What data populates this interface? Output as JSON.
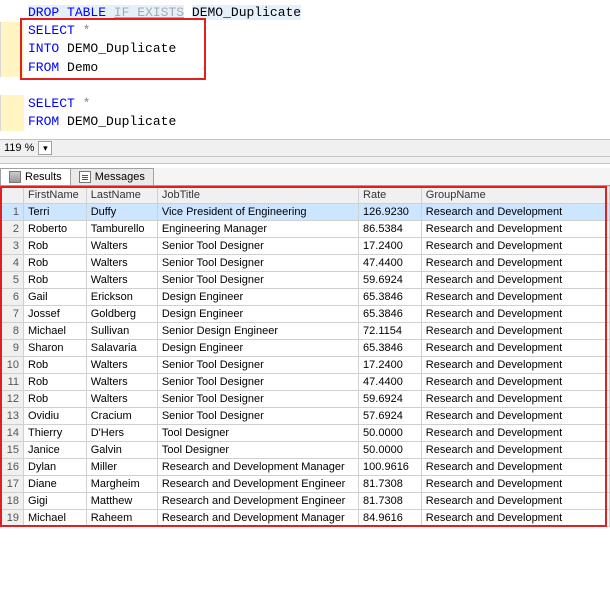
{
  "editor": {
    "l1_drop": "DROP",
    "l1_table": "TABLE",
    "l1_ifexists": "IF EXISTS",
    "l1_obj": "DEMO_Duplicate",
    "l2_select": "SELECT",
    "l2_star": "*",
    "l3_into": "INTO",
    "l3_obj": "DEMO_Duplicate",
    "l4_from": "FROM",
    "l4_obj": "Demo",
    "l6_select": "SELECT",
    "l6_star": "*",
    "l7_from": "FROM",
    "l7_obj": "DEMO_Duplicate"
  },
  "zoom": {
    "value": "119 %"
  },
  "tabs": {
    "results": "Results",
    "messages": "Messages"
  },
  "grid": {
    "headers": {
      "firstname": "FirstName",
      "lastname": "LastName",
      "jobtitle": "JobTitle",
      "rate": "Rate",
      "groupname": "GroupName"
    },
    "rows": [
      {
        "n": "1",
        "fn": "Terri",
        "ln": "Duffy",
        "jt": "Vice President of Engineering",
        "rt": "126.9230",
        "gn": "Research and Development"
      },
      {
        "n": "2",
        "fn": "Roberto",
        "ln": "Tamburello",
        "jt": "Engineering Manager",
        "rt": "86.5384",
        "gn": "Research and Development"
      },
      {
        "n": "3",
        "fn": "Rob",
        "ln": "Walters",
        "jt": "Senior Tool Designer",
        "rt": "17.2400",
        "gn": "Research and Development"
      },
      {
        "n": "4",
        "fn": "Rob",
        "ln": "Walters",
        "jt": "Senior Tool Designer",
        "rt": "47.4400",
        "gn": "Research and Development"
      },
      {
        "n": "5",
        "fn": "Rob",
        "ln": "Walters",
        "jt": "Senior Tool Designer",
        "rt": "59.6924",
        "gn": "Research and Development"
      },
      {
        "n": "6",
        "fn": "Gail",
        "ln": "Erickson",
        "jt": "Design Engineer",
        "rt": "65.3846",
        "gn": "Research and Development"
      },
      {
        "n": "7",
        "fn": "Jossef",
        "ln": "Goldberg",
        "jt": "Design Engineer",
        "rt": "65.3846",
        "gn": "Research and Development"
      },
      {
        "n": "8",
        "fn": "Michael",
        "ln": "Sullivan",
        "jt": "Senior Design Engineer",
        "rt": "72.1154",
        "gn": "Research and Development"
      },
      {
        "n": "9",
        "fn": "Sharon",
        "ln": "Salavaria",
        "jt": "Design Engineer",
        "rt": "65.3846",
        "gn": "Research and Development"
      },
      {
        "n": "10",
        "fn": "Rob",
        "ln": "Walters",
        "jt": "Senior Tool Designer",
        "rt": "17.2400",
        "gn": "Research and Development"
      },
      {
        "n": "11",
        "fn": "Rob",
        "ln": "Walters",
        "jt": "Senior Tool Designer",
        "rt": "47.4400",
        "gn": "Research and Development"
      },
      {
        "n": "12",
        "fn": "Rob",
        "ln": "Walters",
        "jt": "Senior Tool Designer",
        "rt": "59.6924",
        "gn": "Research and Development"
      },
      {
        "n": "13",
        "fn": "Ovidiu",
        "ln": "Cracium",
        "jt": "Senior Tool Designer",
        "rt": "57.6924",
        "gn": "Research and Development"
      },
      {
        "n": "14",
        "fn": "Thierry",
        "ln": "D'Hers",
        "jt": "Tool Designer",
        "rt": "50.0000",
        "gn": "Research and Development"
      },
      {
        "n": "15",
        "fn": "Janice",
        "ln": "Galvin",
        "jt": "Tool Designer",
        "rt": "50.0000",
        "gn": "Research and Development"
      },
      {
        "n": "16",
        "fn": "Dylan",
        "ln": "Miller",
        "jt": "Research and Development Manager",
        "rt": "100.9616",
        "gn": "Research and Development"
      },
      {
        "n": "17",
        "fn": "Diane",
        "ln": "Margheim",
        "jt": "Research and Development Engineer",
        "rt": "81.7308",
        "gn": "Research and Development"
      },
      {
        "n": "18",
        "fn": "Gigi",
        "ln": "Matthew",
        "jt": "Research and Development Engineer",
        "rt": "81.7308",
        "gn": "Research and Development"
      },
      {
        "n": "19",
        "fn": "Michael",
        "ln": "Raheem",
        "jt": "Research and Development Manager",
        "rt": "84.9616",
        "gn": "Research and Development"
      }
    ]
  }
}
